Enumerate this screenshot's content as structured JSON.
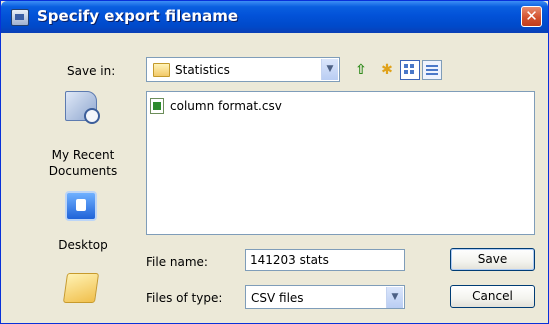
{
  "window": {
    "title": "Specify export filename",
    "close_glyph": "✕"
  },
  "toolbar": {
    "save_in_label": "Save in:",
    "save_in_value": "Statistics",
    "icons": [
      "up-folder-icon",
      "new-folder-icon",
      "thumbnails-view-icon",
      "details-view-icon"
    ]
  },
  "places": [
    {
      "label_line1": "My Recent",
      "label_line2": "Documents",
      "icon": "recent-documents-icon"
    },
    {
      "label_line1": "Desktop",
      "label_line2": "",
      "icon": "desktop-icon"
    },
    {
      "label_line1": "",
      "label_line2": "",
      "icon": "my-documents-icon"
    }
  ],
  "files": [
    {
      "name": "column format.csv",
      "icon": "csv-file-icon"
    }
  ],
  "form": {
    "file_name_label": "File name:",
    "file_name_value": "141203 stats",
    "file_type_label": "Files of type:",
    "file_type_value": "CSV files"
  },
  "buttons": {
    "save": "Save",
    "cancel": "Cancel"
  },
  "colors": {
    "titlebar": "#0252d8",
    "window_face": "#ece9d8",
    "close_button": "#d3522f",
    "field_border": "#7f9db9"
  }
}
